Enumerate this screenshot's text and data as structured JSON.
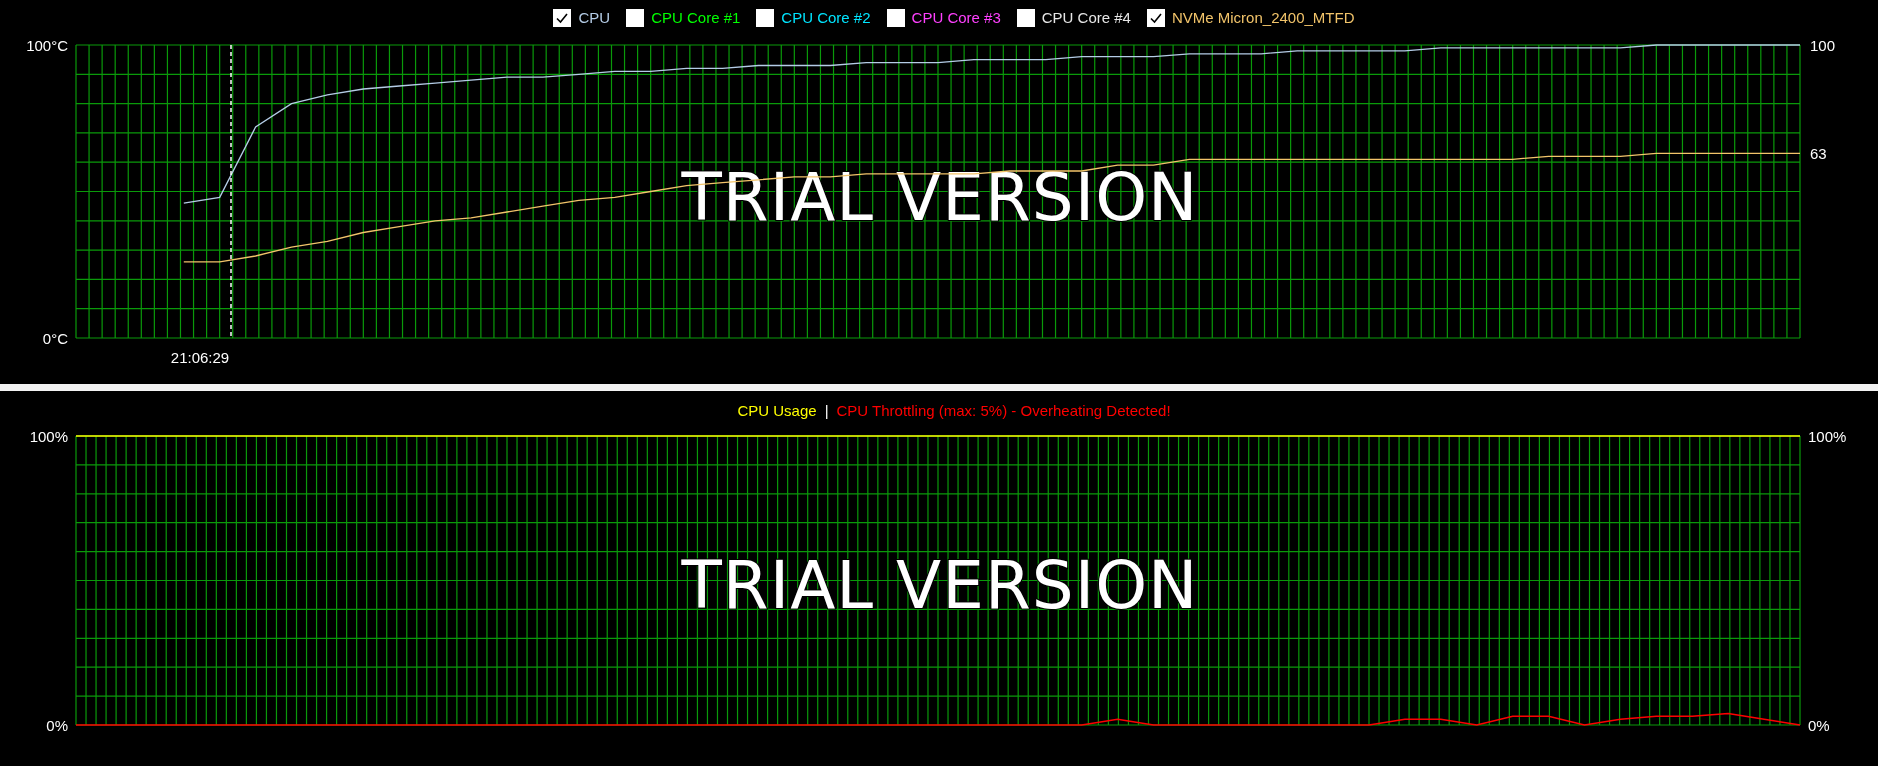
{
  "temperature_panel": {
    "legend": [
      {
        "label": "CPU",
        "checked": true,
        "color": "#b4cce6"
      },
      {
        "label": "CPU Core #1",
        "checked": false,
        "color": "#00ff00"
      },
      {
        "label": "CPU Core #2",
        "checked": false,
        "color": "#00e5ff"
      },
      {
        "label": "CPU Core #3",
        "checked": false,
        "color": "#ff40ff"
      },
      {
        "label": "CPU Core #4",
        "checked": false,
        "color": "#e6e6e6"
      },
      {
        "label": "NVMe Micron_2400_MTFD",
        "checked": true,
        "color": "#f2c46a"
      }
    ],
    "overlay_text": "TRIAL VERSION",
    "end_labels": [
      "100",
      "63"
    ],
    "cursor_time": "21:06:29",
    "chart_data": {
      "type": "line",
      "categories": [
        null,
        null,
        null,
        null,
        null,
        null,
        null,
        null,
        null,
        null,
        null,
        null,
        null,
        null,
        null,
        null,
        null,
        null,
        null,
        null,
        null,
        null,
        null,
        null,
        null,
        null,
        null,
        null,
        null,
        null,
        null,
        null,
        null,
        null,
        null,
        null,
        null,
        null,
        null,
        null,
        null,
        null,
        null,
        null,
        null,
        null,
        null,
        null,
        null
      ],
      "series": [
        {
          "color": "#b4cce6",
          "values": [
            null,
            null,
            null,
            46,
            48,
            72,
            80,
            83,
            85,
            86,
            87,
            88,
            89,
            89,
            90,
            91,
            91,
            92,
            92,
            93,
            93,
            93,
            94,
            94,
            94,
            95,
            95,
            95,
            96,
            96,
            96,
            97,
            97,
            97,
            98,
            98,
            98,
            98,
            99,
            99,
            99,
            99,
            99,
            99,
            100,
            100,
            100,
            100,
            100
          ]
        },
        {
          "color": "#f2c46a",
          "values": [
            null,
            null,
            null,
            26,
            26,
            28,
            31,
            33,
            36,
            38,
            40,
            41,
            43,
            45,
            47,
            48,
            50,
            52,
            53,
            54,
            55,
            55,
            56,
            56,
            56,
            56,
            57,
            57,
            57,
            59,
            59,
            61,
            61,
            61,
            61,
            61,
            61,
            61,
            61,
            61,
            61,
            62,
            62,
            62,
            63,
            63,
            63,
            63,
            63
          ]
        }
      ],
      "ylim": [
        0,
        100
      ],
      "yticks": [
        {
          "value": 0,
          "label": "0°C"
        },
        {
          "value": 100,
          "label": "100°C"
        }
      ],
      "grid": true
    }
  },
  "usage_panel": {
    "legend": [
      {
        "label": "CPU Usage",
        "color": "#ffff00"
      },
      {
        "label": "CPU Throttling (max: 5%) - Overheating Detected!",
        "color": "#ff0000"
      }
    ],
    "legend_separator": "|",
    "overlay_text": "TRIAL VERSION",
    "right_labels": [
      "100%",
      "0%"
    ],
    "chart_data": {
      "type": "line",
      "categories": [
        null,
        null,
        null,
        null,
        null,
        null,
        null,
        null,
        null,
        null,
        null,
        null,
        null,
        null,
        null,
        null,
        null,
        null,
        null,
        null,
        null,
        null,
        null,
        null,
        null,
        null,
        null,
        null,
        null,
        null,
        null,
        null,
        null,
        null,
        null,
        null,
        null,
        null,
        null,
        null,
        null,
        null,
        null,
        null,
        null,
        null,
        null,
        null,
        null
      ],
      "series": [
        {
          "color": "#ffff00",
          "values": [
            100,
            100,
            100,
            100,
            100,
            100,
            100,
            100,
            100,
            100,
            100,
            100,
            100,
            100,
            100,
            100,
            100,
            100,
            100,
            100,
            100,
            100,
            100,
            100,
            100,
            100,
            100,
            100,
            100,
            100,
            100,
            100,
            100,
            100,
            100,
            100,
            100,
            100,
            100,
            100,
            100,
            100,
            100,
            100,
            100,
            100,
            100,
            100,
            100
          ]
        },
        {
          "color": "#ff0000",
          "values": [
            0,
            0,
            0,
            0,
            0,
            0,
            0,
            0,
            0,
            0,
            0,
            0,
            0,
            0,
            0,
            0,
            0,
            0,
            0,
            0,
            0,
            0,
            0,
            0,
            0,
            0,
            0,
            0,
            0,
            2,
            0,
            0,
            0,
            0,
            0,
            0,
            0,
            2,
            2,
            0,
            3,
            3,
            0,
            2,
            3,
            3,
            4,
            2,
            0
          ]
        }
      ],
      "ylim": [
        0,
        100
      ],
      "yticks": [
        {
          "value": 0,
          "label": "0%"
        },
        {
          "value": 100,
          "label": "100%"
        }
      ],
      "grid": true
    }
  }
}
